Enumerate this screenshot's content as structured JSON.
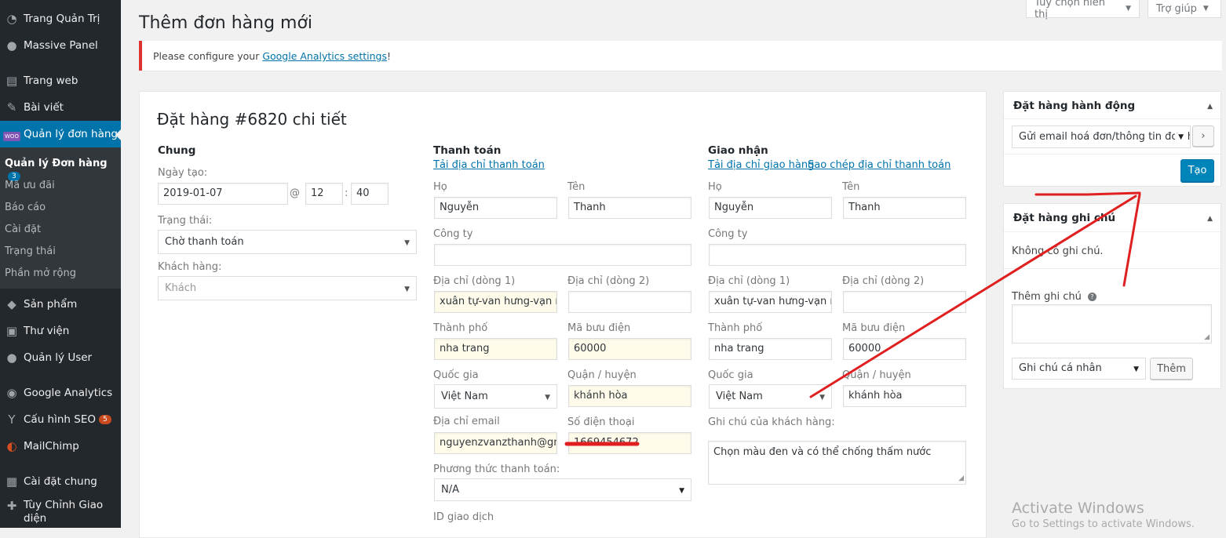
{
  "sidebar": {
    "dashboard": "Trang Quản Trị",
    "massive_panel": "Massive Panel",
    "pages": "Trang web",
    "posts": "Bài viết",
    "orders": "Quản lý đơn hàng",
    "orders_icon_label": "WOO",
    "submenu": {
      "orders": "Quản lý Đơn hàng",
      "orders_count": "3",
      "coupons": "Mã ưu đãi",
      "reports": "Báo cáo",
      "settings": "Cài đặt",
      "status": "Trạng thái",
      "extensions": "Phần mở rộng"
    },
    "products": "Sản phẩm",
    "media": "Thư viện",
    "users": "Quản lý User",
    "analytics": "Google Analytics",
    "seo": "Cấu hình SEO",
    "seo_count": "5",
    "mailchimp": "MailChimp",
    "settings": "Cài đặt chung",
    "customize_line1": "Tùy Chỉnh Giao",
    "customize_line2": "diện"
  },
  "header": {
    "screen_options": "Tùy chọn hiển thị",
    "help": "Trợ giúp",
    "title": "Thêm đơn hàng mới"
  },
  "notice": {
    "before": "Please configure your ",
    "link": "Google Analytics settings",
    "after": "!"
  },
  "order": {
    "title": "Đặt hàng #6820 chi tiết",
    "general": {
      "title": "Chung",
      "date_label": "Ngày tạo:",
      "date": "2019-01-07",
      "at": "@",
      "hour": "12",
      "colon": ":",
      "minute": "40",
      "status_label": "Trạng thái:",
      "status": "Chờ thanh toán",
      "customer_label": "Khách hàng:",
      "customer": "Khách"
    },
    "billing": {
      "title": "Thanh toán",
      "load_link": "Tải địa chỉ thanh toán",
      "first_name_label": "Họ",
      "first_name": "Nguyễn",
      "last_name_label": "Tên",
      "last_name": "Thanh",
      "company_label": "Công ty",
      "company": "",
      "address1_label": "Địa chỉ (dòng 1)",
      "address1": "xuân tự-van hưng-vạn ninh",
      "address2_label": "Địa chỉ (dòng 2)",
      "address2": "",
      "city_label": "Thành phố",
      "city": "nha trang",
      "postcode_label": "Mã bưu điện",
      "postcode": "60000",
      "country_label": "Quốc gia",
      "country": "Việt Nam",
      "district_label": "Quận / huyện",
      "district": "khánh hòa",
      "email_label": "Địa chỉ email",
      "email": "nguyenzvanzthanh@gmail.com",
      "phone_label": "Số điện thoại",
      "phone": "1669454672",
      "payment_label": "Phương thức thanh toán:",
      "payment": "N/A",
      "transaction_label": "ID giao dịch"
    },
    "shipping": {
      "title": "Giao nhận",
      "load_link": "Tải địa chỉ giao hàng",
      "copy_link": "Sao chép địa chỉ thanh toán",
      "first_name_label": "Họ",
      "first_name": "Nguyễn",
      "last_name_label": "Tên",
      "last_name": "Thanh",
      "company_label": "Công ty",
      "company": "",
      "address1_label": "Địa chỉ (dòng 1)",
      "address1": "xuân tự-van hưng-vạn ninh",
      "address2_label": "Địa chỉ (dòng 2)",
      "address2": "",
      "city_label": "Thành phố",
      "city": "nha trang",
      "postcode_label": "Mã bưu điện",
      "postcode": "60000",
      "country_label": "Quốc gia",
      "country": "Việt Nam",
      "district_label": "Quận / huyện",
      "district": "khánh hòa",
      "note_label": "Ghi chú của khách hàng:",
      "note": "Chọn màu đen và có thể chống thấm nước"
    }
  },
  "actions_box": {
    "title": "Đặt hàng hành động",
    "action": "Gửi email hoá đơn/thông tin đơn hàng",
    "go": "›",
    "create": "Tạo"
  },
  "notes_box": {
    "title": "Đặt hàng ghi chú",
    "empty": "Không có ghi chú.",
    "add_label": "Thêm ghi chú",
    "help": "?",
    "note_type": "Ghi chú cá nhân",
    "add_button": "Thêm"
  },
  "watermark": {
    "line1": "Activate Windows",
    "line2": "Go to Settings to activate Windows."
  },
  "colors": {
    "sidebar": "#23282d",
    "submenu": "#32373c",
    "accent": "#0073aa",
    "highlight_input": "#fefbeb",
    "annotation": "#e02020"
  }
}
